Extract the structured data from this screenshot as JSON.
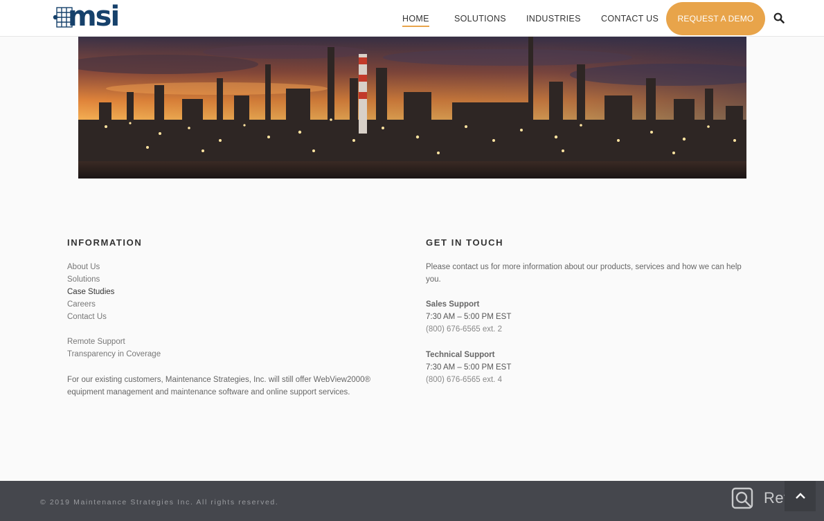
{
  "header": {
    "logo_text": "msi",
    "nav": [
      {
        "label": "HOME",
        "active": true
      },
      {
        "label": "SOLUTIONS",
        "active": false
      },
      {
        "label": "INDUSTRIES",
        "active": false
      },
      {
        "label": "CONTACT US",
        "active": false
      }
    ],
    "cta_label": "REQUEST A DEMO",
    "search_icon": "search-icon",
    "accent_color": "#e8a44a",
    "brand_color": "#16416b"
  },
  "hero": {
    "image": "refinery-at-sunset"
  },
  "information": {
    "title": "INFORMATION",
    "links_primary": [
      "About Us",
      "Solutions",
      "Case Studies",
      "Careers",
      "Contact Us"
    ],
    "links_secondary": [
      "Remote Support",
      "Transparency in Coverage"
    ],
    "note": "For our existing customers, Maintenance Strategies, Inc. will still offer WebView2000® equipment management and maintenance software and online support services."
  },
  "contact": {
    "title": "GET IN TOUCH",
    "intro": "Please contact us for more information about our products, services and how we can help you.",
    "sales": {
      "label": "Sales Support",
      "hours": "7:30 AM – 5:00 PM EST",
      "phone": "(800) 676-6565 ext. 2"
    },
    "technical": {
      "label": "Technical Support",
      "hours": "7:30 AM – 5:00 PM EST",
      "phone": "(800) 676-6565 ext. 4"
    }
  },
  "footer": {
    "copyright": "© 2019 Maintenance Strategies Inc. All rights reserved.",
    "watermark": "Revain",
    "back_to_top_icon": "chevron-up-icon",
    "bar_color": "#45474d"
  }
}
